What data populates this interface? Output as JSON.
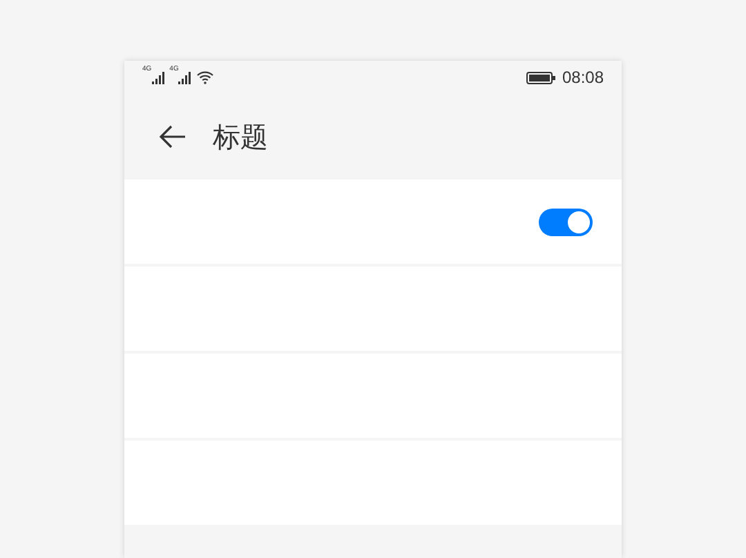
{
  "status_bar": {
    "networks": [
      "4G",
      "4G"
    ],
    "time": "08:08"
  },
  "header": {
    "title": "标题"
  },
  "rows": [
    {
      "kind": "toggle",
      "on": true
    },
    {
      "kind": "empty"
    },
    {
      "kind": "empty"
    },
    {
      "kind": "empty"
    }
  ]
}
